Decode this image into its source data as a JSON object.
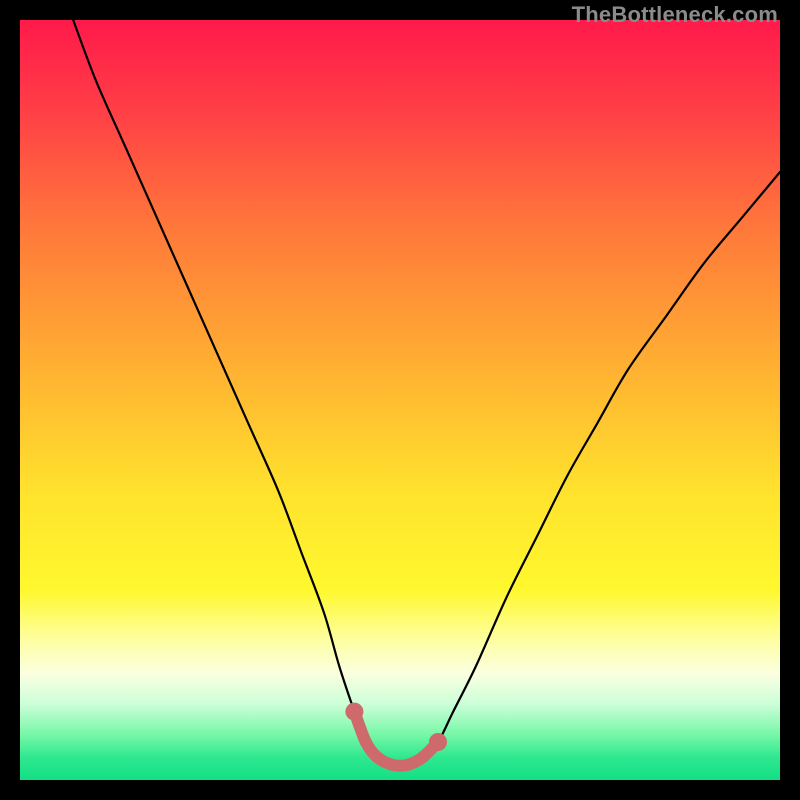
{
  "watermark": "TheBottleneck.com",
  "colors": {
    "frame": "#000000",
    "curve": "#000000",
    "marker_stroke": "#cf6a6c",
    "marker_fill": "#cf6a6c",
    "gradient_stops": [
      {
        "offset": 0.0,
        "color": "#ff1a4b"
      },
      {
        "offset": 0.12,
        "color": "#ff3f46"
      },
      {
        "offset": 0.28,
        "color": "#ff7a3a"
      },
      {
        "offset": 0.45,
        "color": "#ffae32"
      },
      {
        "offset": 0.62,
        "color": "#ffe22d"
      },
      {
        "offset": 0.75,
        "color": "#fff82e"
      },
      {
        "offset": 0.82,
        "color": "#fdffa8"
      },
      {
        "offset": 0.86,
        "color": "#fbffe0"
      },
      {
        "offset": 0.9,
        "color": "#ccffd8"
      },
      {
        "offset": 0.94,
        "color": "#77f7a8"
      },
      {
        "offset": 0.97,
        "color": "#2fe890"
      },
      {
        "offset": 1.0,
        "color": "#13df85"
      }
    ]
  },
  "chart_data": {
    "type": "line",
    "title": "",
    "xlabel": "",
    "ylabel": "",
    "xlim": [
      0,
      100
    ],
    "ylim": [
      0,
      100
    ],
    "series": [
      {
        "name": "bottleneck-curve",
        "x": [
          7,
          10,
          14,
          18,
          22,
          26,
          30,
          34,
          37,
          40,
          42,
          44,
          45.5,
          47,
          49,
          51,
          53,
          55,
          57,
          60,
          64,
          68,
          72,
          76,
          80,
          85,
          90,
          95,
          100
        ],
        "y": [
          100,
          92,
          83,
          74,
          65,
          56,
          47,
          38,
          30,
          22,
          15,
          9,
          5,
          3,
          2,
          2,
          3,
          5,
          9,
          15,
          24,
          32,
          40,
          47,
          54,
          61,
          68,
          74,
          80
        ]
      }
    ],
    "highlight": {
      "name": "optimal-range",
      "x": [
        44,
        45.5,
        47,
        49,
        51,
        53,
        55
      ],
      "y": [
        9,
        5,
        3,
        2,
        2,
        3,
        5
      ]
    }
  }
}
